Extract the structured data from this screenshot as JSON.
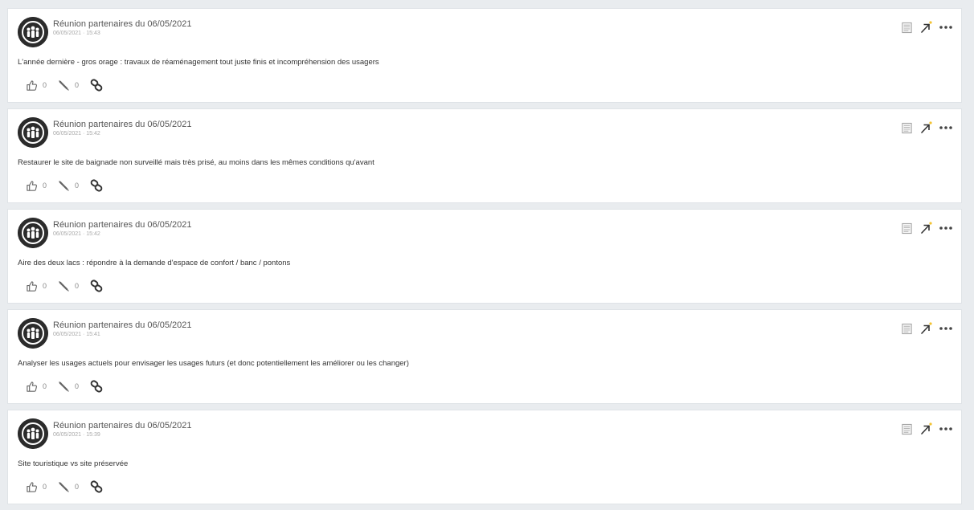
{
  "colors": {
    "page_background": "#e9ecef",
    "card_background": "#ffffff",
    "avatar": "#2b2b2b",
    "icon": "#666666",
    "accent_arrow": "#333333",
    "sparkle": "#f2c230"
  },
  "icons": {
    "avatar": "group-avatar-icon",
    "like": "thumbs-up-icon",
    "comment": "pencil-icon",
    "link": "chain-link-icon",
    "note": "notepad-icon",
    "move": "arrow-up-right-icon",
    "more": "ellipsis-icon"
  },
  "posts": [
    {
      "title": "Réunion partenaires du 06/05/2021",
      "meta": "06/05/2021 · 15:43",
      "body": "L'année dernière - gros orage : travaux de réaménagement tout juste finis et incompréhension des usagers",
      "likes": "0",
      "comments": "0"
    },
    {
      "title": "Réunion partenaires du 06/05/2021",
      "meta": "06/05/2021 · 15:42",
      "body": "Restaurer le site de baignade non surveillé mais très prisé, au moins dans les mêmes conditions qu'avant",
      "likes": "0",
      "comments": "0"
    },
    {
      "title": "Réunion partenaires du 06/05/2021",
      "meta": "06/05/2021 · 15:42",
      "body": "Aire des deux lacs : répondre à la demande d'espace de confort / banc / pontons",
      "likes": "0",
      "comments": "0"
    },
    {
      "title": "Réunion partenaires du 06/05/2021",
      "meta": "06/05/2021 · 15:41",
      "body": "Analyser les usages actuels pour envisager les usages futurs (et donc potentiellement les améliorer ou les changer)",
      "likes": "0",
      "comments": "0"
    },
    {
      "title": "Réunion partenaires du 06/05/2021",
      "meta": "06/05/2021 · 15:39",
      "body": "Site touristique vs site préservée",
      "likes": "0",
      "comments": "0"
    }
  ]
}
